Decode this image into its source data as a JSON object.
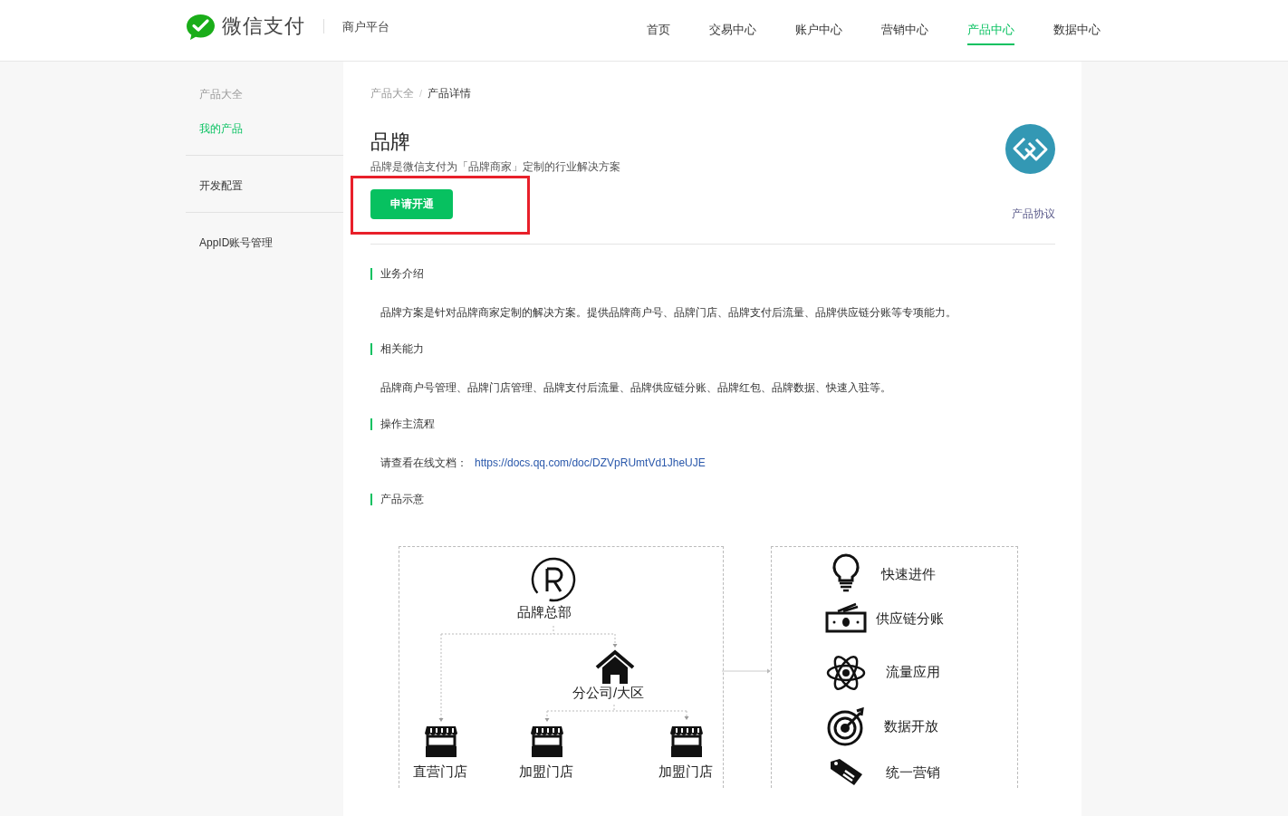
{
  "header": {
    "brand": "微信支付",
    "platform": "商户平台",
    "nav": [
      {
        "label": "首页",
        "selected": false
      },
      {
        "label": "交易中心",
        "selected": false
      },
      {
        "label": "账户中心",
        "selected": false
      },
      {
        "label": "营销中心",
        "selected": false
      },
      {
        "label": "产品中心",
        "selected": true
      },
      {
        "label": "数据中心",
        "selected": false
      }
    ]
  },
  "sidebar": {
    "groups": [
      {
        "items": [
          {
            "label": "产品大全",
            "kind": "heading"
          },
          {
            "label": "我的产品",
            "kind": "link",
            "selected": true
          }
        ]
      },
      {
        "items": [
          {
            "label": "开发配置",
            "kind": "link",
            "selected": false
          }
        ]
      },
      {
        "items": [
          {
            "label": "AppID账号管理",
            "kind": "link",
            "selected": false
          }
        ]
      }
    ]
  },
  "breadcrumb": {
    "items": [
      "产品大全",
      "产品详情"
    ],
    "separator": "/"
  },
  "product": {
    "title": "品牌",
    "description": "品牌是微信支付为「品牌商家」定制的行业解决方案",
    "apply_button": {
      "label": "申请开通",
      "highlighted": true
    },
    "agreement_link": "产品协议"
  },
  "sections": [
    {
      "heading": "业务介绍",
      "kind": "text",
      "text": "品牌方案是针对品牌商家定制的解决方案。提供品牌商户号、品牌门店、品牌支付后流量、品牌供应链分账等专项能力。"
    },
    {
      "heading": "相关能力",
      "kind": "text",
      "text": "品牌商户号管理、品牌门店管理、品牌支付后流量、品牌供应链分账、品牌红包、品牌数据、快速入驻等。"
    },
    {
      "heading": "操作主流程",
      "kind": "link",
      "text": "请查看在线文档：",
      "url": "https://docs.qq.com/doc/DZVpRUmtVd1JheUJE"
    },
    {
      "heading": "产品示意",
      "kind": "diagram"
    }
  ],
  "diagram": {
    "headquarters": "品牌总部",
    "branch": "分公司/大区",
    "stores": [
      "直营门店",
      "加盟门店",
      "加盟门店"
    ],
    "features": [
      "快速进件",
      "供应链分账",
      "流量应用",
      "数据开放",
      "统一营销"
    ]
  }
}
